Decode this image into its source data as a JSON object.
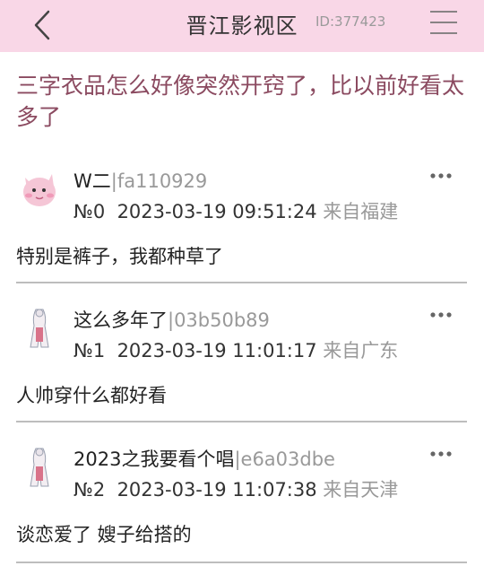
{
  "header": {
    "title": "晋江影视区",
    "board_id": "ID:377423"
  },
  "thread": {
    "title": "三字衣品怎么好像突然开窍了，比以前好看太多了"
  },
  "posts": [
    {
      "author": "W二",
      "uid": "|fa110929",
      "floor": "№0",
      "datetime": "2023-03-19 09:51:24",
      "source": "来自福建",
      "content": "特别是裤子，我都种草了"
    },
    {
      "author": "这么多年了",
      "uid": "|03b50b89",
      "floor": "№1",
      "datetime": "2023-03-19 11:01:17",
      "source": "来自广东",
      "content": "人帅穿什么都好看"
    },
    {
      "author": "2023之我要看个唱",
      "uid": "|e6a03dbe",
      "floor": "№2",
      "datetime": "2023-03-19 11:07:38",
      "source": "来自天津",
      "content": "谈恋爱了 嫂子给搭的"
    }
  ],
  "colors": {
    "header_bg": "#f9d7e7",
    "thread_title": "#8b4a60",
    "muted": "#999999"
  },
  "icons": {
    "back": "chevron-left-icon",
    "menu": "hamburger-menu-icon",
    "more": "more-dots-icon",
    "avatar_0": "pink-creature-avatar",
    "avatar_1": "doll-figure-avatar",
    "avatar_2": "doll-figure-avatar"
  }
}
